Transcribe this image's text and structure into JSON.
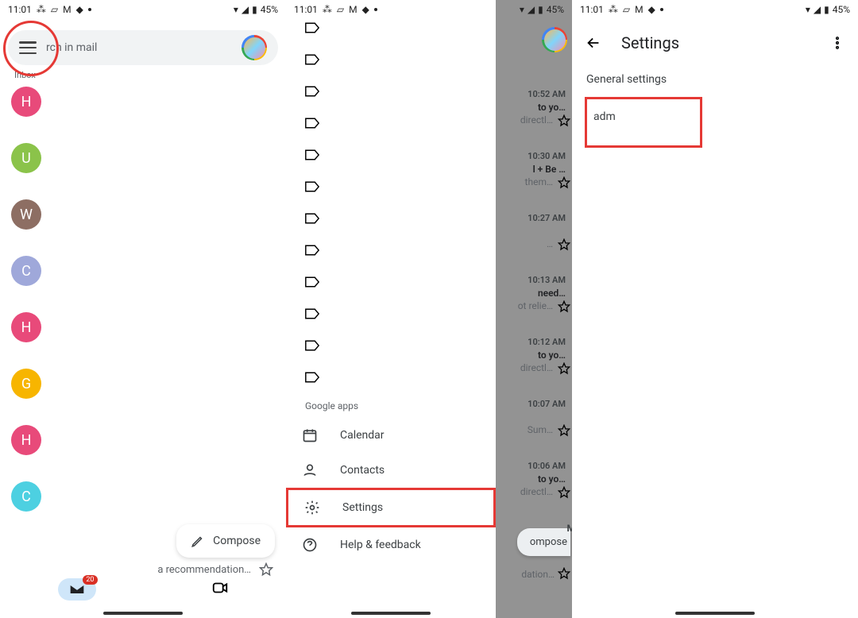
{
  "status": {
    "time": "11:01",
    "battery": "45%"
  },
  "panel1": {
    "search_placeholder": "Search in mail",
    "search_visible": "rch in mail",
    "inbox_label": "Inbox",
    "chips": [
      {
        "letter": "H",
        "color": "c-pink"
      },
      {
        "letter": "U",
        "color": "c-green"
      },
      {
        "letter": "W",
        "color": "c-brown"
      },
      {
        "letter": "C",
        "color": "c-lav"
      },
      {
        "letter": "H",
        "color": "c-pink"
      },
      {
        "letter": "G",
        "color": "c-yellow"
      },
      {
        "letter": "H",
        "color": "c-pink"
      },
      {
        "letter": "C",
        "color": "c-teal"
      }
    ],
    "compose": "Compose",
    "snippet": "a recommendation…",
    "nav_badge": "20"
  },
  "panel2": {
    "google_apps": "Google apps",
    "items": {
      "calendar": "Calendar",
      "contacts": "Contacts",
      "settings": "Settings",
      "help": "Help & feedback"
    },
    "emails": [
      {
        "time": "10:52 AM",
        "l1": "to yo…",
        "l2": "directl…"
      },
      {
        "time": "10:30 AM",
        "l1": "l + Be …",
        "l2": "them…"
      },
      {
        "time": "10:27 AM",
        "l1": "",
        "l2": "…"
      },
      {
        "time": "10:13 AM",
        "l1": "need…",
        "l2": "ot relie…"
      },
      {
        "time": "10:12 AM",
        "l1": "to yo…",
        "l2": "directl…"
      },
      {
        "time": "10:07 AM",
        "l1": "",
        "l2": "Sum…"
      },
      {
        "time": "10:06 AM",
        "l1": "to yo…",
        "l2": "directl…"
      }
    ],
    "compose": "ompose",
    "trailing": "M",
    "bottom_snippet": "dation…"
  },
  "panel3": {
    "title": "Settings",
    "general": "General settings",
    "item": "adm"
  }
}
